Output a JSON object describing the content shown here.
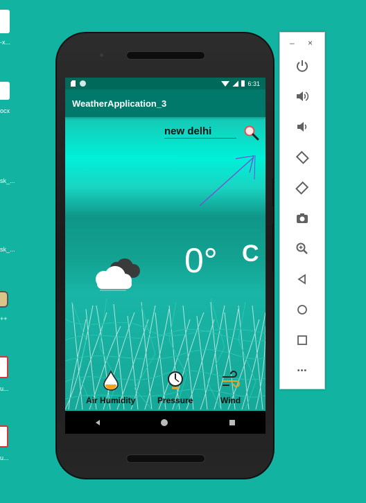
{
  "desktop": {
    "icons": [
      {
        "label": "-x..."
      },
      {
        "label": "ocx"
      },
      {
        "label": "sk_..."
      },
      {
        "label": "sk_..."
      },
      {
        "label": "++"
      },
      {
        "label": "u..."
      },
      {
        "label": "u..."
      }
    ]
  },
  "status_bar": {
    "time": "6:31"
  },
  "app": {
    "title": "WeatherApplication_3",
    "search": {
      "value": "new delhi"
    },
    "temperature": "0°",
    "unit": "C",
    "metrics": [
      {
        "label": "Air Humidity",
        "icon": "humidity-drop-icon"
      },
      {
        "label": "Pressure",
        "icon": "pressure-gauge-icon"
      },
      {
        "label": "Wind",
        "icon": "wind-icon"
      }
    ]
  },
  "emulator_toolbar": {
    "minimize": "–",
    "close": "×",
    "buttons": [
      "power-icon",
      "volume-up-icon",
      "volume-down-icon",
      "rotate-left-icon",
      "rotate-right-icon",
      "camera-icon",
      "zoom-icon",
      "back-icon",
      "home-icon",
      "overview-icon",
      "more-icon"
    ],
    "more_label": "•••"
  },
  "colors": {
    "desktop_bg": "#13b3a2",
    "app_bar": "#00796b",
    "status_bar": "#00695a",
    "accent": "#7a2ad8",
    "toolbar_icon": "#616161"
  }
}
